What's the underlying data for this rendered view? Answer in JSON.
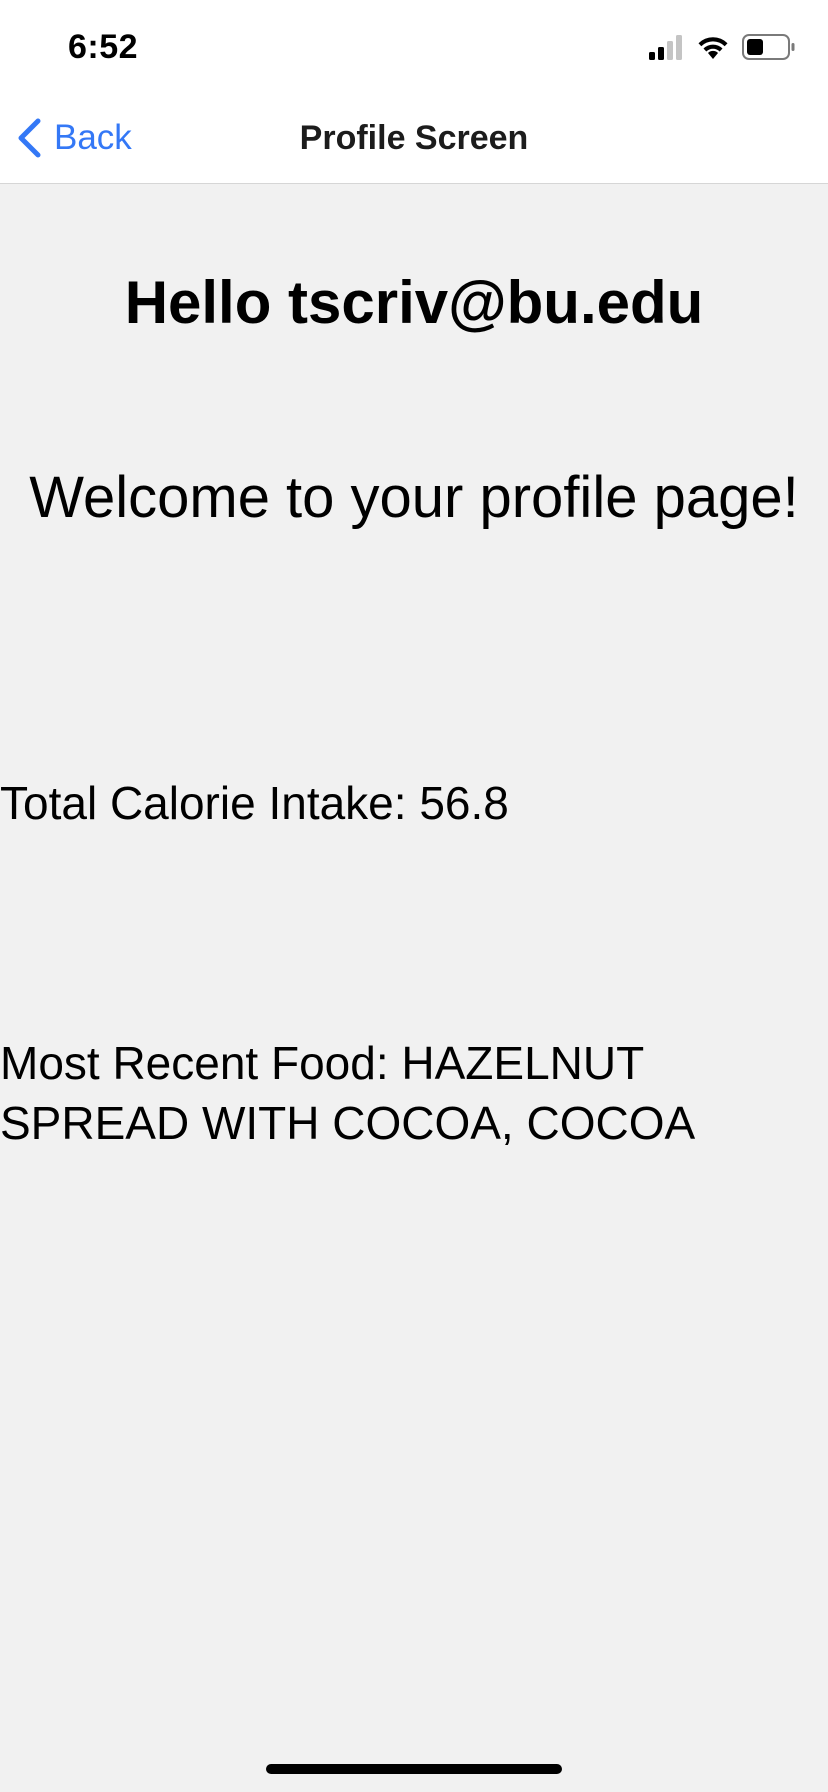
{
  "status_bar": {
    "time": "6:52",
    "icons": [
      "cellular-signal-icon",
      "wifi-icon",
      "battery-icon"
    ]
  },
  "nav": {
    "back_label": "Back",
    "title": "Profile Screen"
  },
  "profile": {
    "greeting": "Hello tscriv@bu.edu",
    "welcome": "Welcome to your profile page!",
    "calories_text": "Total Calorie Intake: 56.8",
    "recent_food_text": "Most Recent Food: HAZELNUT SPREAD WITH COCOA, COCOA"
  },
  "colors": {
    "accent": "#3478f6",
    "background": "#f1f1f1",
    "bar_background": "#ffffff"
  }
}
